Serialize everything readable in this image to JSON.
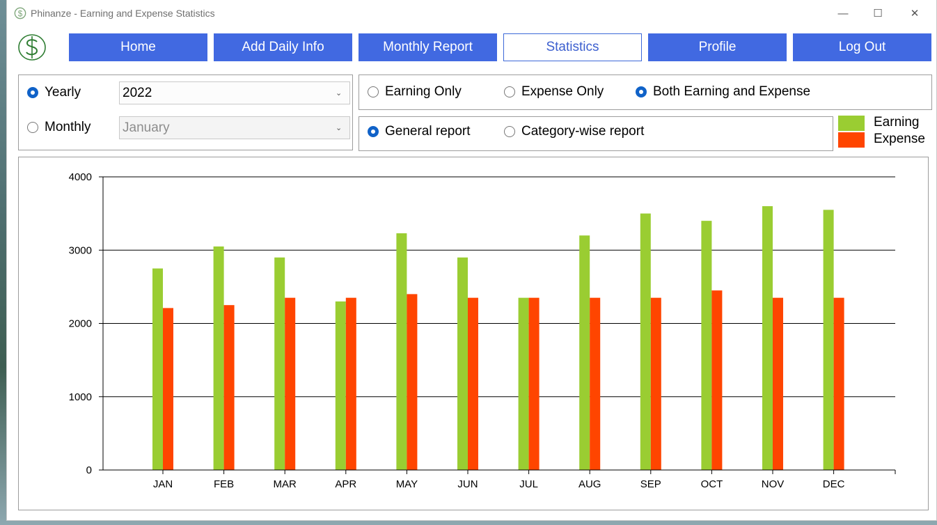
{
  "window": {
    "title": "Phinanze - Earning and Expense Statistics",
    "controls": {
      "minimize": "—",
      "maximize": "☐",
      "close": "✕"
    }
  },
  "nav": {
    "items": [
      {
        "label": "Home",
        "active": false
      },
      {
        "label": "Add Daily Info",
        "active": false
      },
      {
        "label": "Monthly Report",
        "active": false
      },
      {
        "label": "Statistics",
        "active": true
      },
      {
        "label": "Profile",
        "active": false
      },
      {
        "label": "Log Out",
        "active": false
      }
    ]
  },
  "period": {
    "yearly_label": "Yearly",
    "yearly_selected": true,
    "year_value": "2022",
    "monthly_label": "Monthly",
    "monthly_selected": false,
    "month_value": "January"
  },
  "type": {
    "earning_only": "Earning Only",
    "expense_only": "Expense Only",
    "both": "Both Earning and Expense",
    "selected": "both"
  },
  "report": {
    "general": "General report",
    "category": "Category-wise report",
    "selected": "general"
  },
  "legend": {
    "earning_label": "Earning",
    "expense_label": "Expense"
  },
  "colors": {
    "accent": "#4169e1",
    "earning": "#9acd32",
    "expense": "#ff4500"
  },
  "icons": {
    "logo": "dollar-circle-icon",
    "chevron": "chevron-down-icon"
  },
  "chart_data": {
    "type": "bar",
    "categories": [
      "JAN",
      "FEB",
      "MAR",
      "APR",
      "MAY",
      "JUN",
      "JUL",
      "AUG",
      "SEP",
      "OCT",
      "NOV",
      "DEC"
    ],
    "series": [
      {
        "name": "Earning",
        "color": "#9acd32",
        "values": [
          2750,
          3050,
          2900,
          2300,
          3230,
          2900,
          2350,
          3200,
          3500,
          3400,
          3600,
          3550
        ]
      },
      {
        "name": "Expense",
        "color": "#ff4500",
        "values": [
          2210,
          2250,
          2350,
          2350,
          2400,
          2350,
          2350,
          2350,
          2350,
          2450,
          2350,
          2350
        ]
      }
    ],
    "yticks": [
      "0",
      "1000",
      "2000",
      "3000",
      "4000"
    ],
    "ylim": [
      0,
      4000
    ],
    "grid": true
  }
}
